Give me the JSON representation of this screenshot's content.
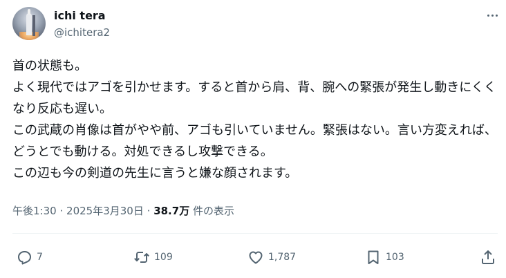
{
  "author": {
    "display_name": "ichi tera",
    "handle": "@ichitera2"
  },
  "tweet": {
    "text": "首の状態も。\nよく現代ではアゴを引かせます。すると首から肩、背、腕への緊張が発生し動きにくくなり反応も遅い。\nこの武蔵の肖像は首がやや前、アゴも引いていません。緊張はない。言い方変えれば、どうとでも動ける。対処できるし攻撃できる。\nこの辺も今の剣道の先生に言うと嫌な顔されます。",
    "time": "午後1:30",
    "date": "2025年3月30日",
    "separator": "·",
    "views_count": "38.7万",
    "views_label": "件の表示"
  },
  "actions": {
    "reply_count": "7",
    "retweet_count": "109",
    "like_count": "1,787",
    "bookmark_count": "103"
  },
  "icons": {
    "reply": "reply-icon",
    "retweet": "retweet-icon",
    "like": "heart-icon",
    "bookmark": "bookmark-icon",
    "share": "share-icon",
    "more": "more-icon"
  },
  "colors": {
    "text": "#0f1419",
    "muted": "#536471",
    "divider": "#eff3f4"
  }
}
